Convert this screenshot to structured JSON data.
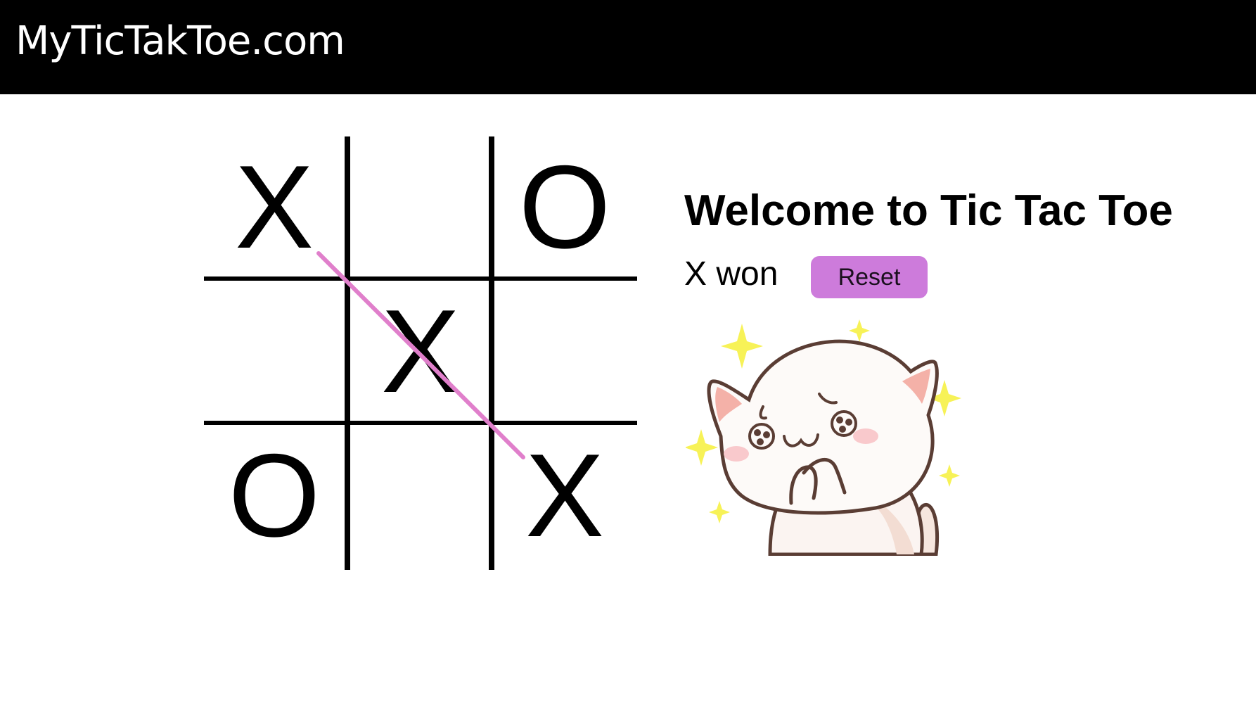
{
  "header": {
    "site_title": "MyTicTakToe.com"
  },
  "board": {
    "cells": [
      "X",
      "",
      "O",
      "",
      "X",
      "",
      "O",
      "",
      "X"
    ],
    "winning_line": [
      0,
      4,
      8
    ],
    "winner": "X"
  },
  "panel": {
    "welcome_title": "Welcome to Tic Tac Toe",
    "status_text": "X won",
    "reset_label": "Reset"
  },
  "sticker": {
    "icon": "crying-cat-sticker"
  },
  "colors": {
    "header_bg": "#000000",
    "win_line": "#e07fcb",
    "reset_button": "#cd7bdb",
    "sparkle": "#f7f257"
  }
}
